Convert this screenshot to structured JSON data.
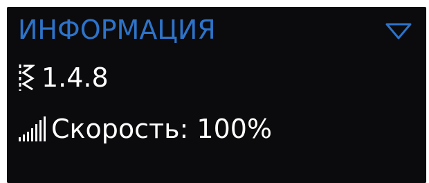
{
  "info_panel": {
    "title": "ИНФОРМАЦИЯ",
    "accent_color": "#2d73c9",
    "background_color": "#0b0b0d",
    "text_color": "#ffffff",
    "collapse_icon": "chevron-down-icon",
    "version": {
      "icon": "stitch-zigzag-icon",
      "value": "1.4.8"
    },
    "speed": {
      "icon": "signal-bars-icon",
      "text": "Скорость: 100%"
    }
  }
}
